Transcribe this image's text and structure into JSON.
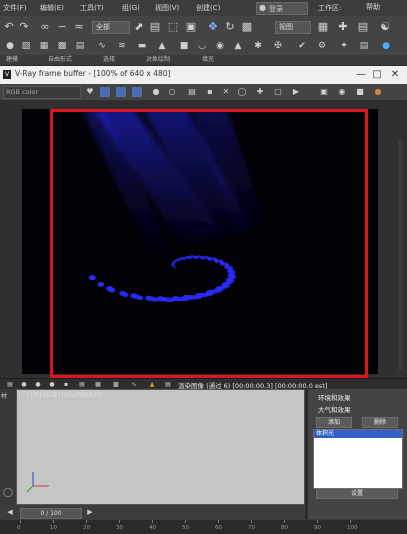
{
  "menu": {
    "items": [
      "文件(F)",
      "编辑(E)",
      "工具(T)",
      "组(G)",
      "视图(V)",
      "创建(C)"
    ],
    "search_text": "登录",
    "workspace": "工作区:",
    "help": "帮助"
  },
  "toolbar": {
    "selection_filter": "全部",
    "view_dropdown": "视图"
  },
  "ribbon_tabs": [
    "建模",
    "自由形式",
    "选择",
    "对象绘制",
    "填充"
  ],
  "vfb": {
    "title": "V-Ray frame buffer - [100% of 640 x 480]",
    "channel": "RGB color"
  },
  "status_bar": {
    "text": "渲染图像 (通过 6) [00:00:00.3] [00:00:00.0 est]"
  },
  "right_panel": {
    "heading1": "环境和效果",
    "heading2": "大气和效果",
    "add_label": "添加",
    "delete_label": "删除",
    "effect_item": "体积光",
    "setup_label": "设置"
  },
  "viewport": {
    "label": "[+] [前] [标准] [默认明暗处理]"
  },
  "frame_bar": {
    "frame_text": "0 / 100"
  },
  "ruler": {
    "ticks": [
      "0",
      "10",
      "20",
      "30",
      "40",
      "50",
      "60",
      "70",
      "80",
      "90",
      "100"
    ]
  },
  "colors": {
    "highlight": "#e0121f",
    "render_bg": "#010106",
    "spiral": "#2a2cff"
  },
  "icons": {
    "toolbar1": [
      "undo-icon",
      "redo-icon",
      "link-icon",
      "unlink-icon",
      "bind-space-warp-icon",
      "selection-filter-dropdown",
      "select-icon",
      "select-by-name-icon",
      "rect-select-icon",
      "window-crossing-icon",
      "move-icon",
      "rotate-icon",
      "scale-icon",
      "view-dropdown",
      "pivot-icon",
      "snap-icon",
      "render-setup-icon",
      "render-frame-icon"
    ],
    "toolbar2": [
      "sphere-icon",
      "box-icon",
      "cylinder-icon",
      "light-icon",
      "camera-icon",
      "helper-icon"
    ]
  }
}
